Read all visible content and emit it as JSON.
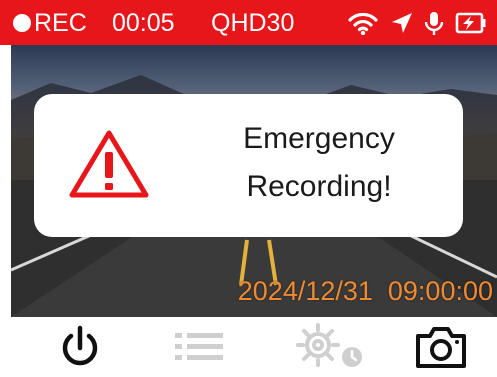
{
  "status_bar": {
    "rec_label": "REC",
    "elapsed": "00:05",
    "quality": "QHD30",
    "bar_color": "#e7161b",
    "icons": [
      "wifi-icon",
      "gps-arrow-icon",
      "microphone-icon",
      "battery-charging-icon"
    ]
  },
  "dialog": {
    "icon": "warning-triangle-icon",
    "line1": "Emergency",
    "line2": "Recording!",
    "icon_color": "#e7161b"
  },
  "overlay": {
    "timestamp": "2024/12/31  09:00:00",
    "timestamp_color": "#f08a30"
  },
  "toolbar": {
    "icons": [
      "power-icon",
      "menu-icon",
      "settings-icon",
      "camera-icon"
    ],
    "disabled_color": "#cfcfcf"
  }
}
